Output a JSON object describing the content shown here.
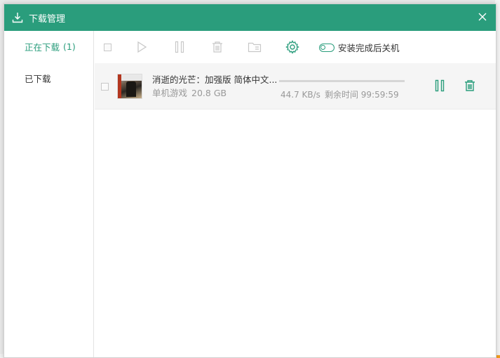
{
  "window": {
    "title": "下载管理"
  },
  "sidebar": {
    "items": [
      {
        "label": "正在下载",
        "count": "(1)",
        "active": true
      },
      {
        "label": "已下载",
        "count": "",
        "active": false
      }
    ]
  },
  "toolbar": {
    "buttons": [
      "select-all-checkbox",
      "play-icon",
      "pause-icon",
      "trash-icon",
      "folder-icon",
      "gear-icon"
    ],
    "shutdown_toggle_label": "安装完成后关机",
    "shutdown_toggle_on": false
  },
  "downloads": [
    {
      "name": "消逝的光芒：加强版  简体中文...",
      "category": "单机游戏",
      "size": "20.8 GB",
      "speed": "44.7 KB/s",
      "remaining": "剩余时间 99:59:59",
      "progress_fraction": 0.0
    }
  ],
  "colors": {
    "accent": "#2a9d7c",
    "muted_icon": "#c8c8c8",
    "text": "#333333",
    "secondary_text": "#999999"
  }
}
